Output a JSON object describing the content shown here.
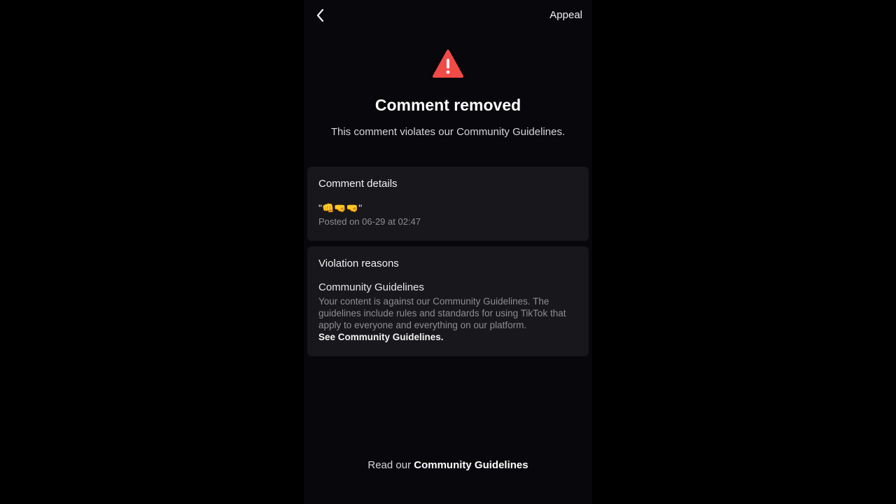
{
  "header": {
    "back_icon": "chevron-left-icon",
    "appeal_label": "Appeal"
  },
  "status": {
    "icon": "warning-triangle-icon",
    "icon_color": "#f04b46",
    "title": "Comment removed",
    "subtitle": "This comment violates our Community Guidelines."
  },
  "comment_details": {
    "heading": "Comment details",
    "comment": "\"👊🤜🤜\"",
    "posted": "Posted on 06-29 at 02:47"
  },
  "violation": {
    "heading": "Violation reasons",
    "reason_title": "Community Guidelines",
    "reason_body": "Your content is against our Community Guidelines. The guidelines include rules and standards for using TikTok that apply to everyone and everything on our platform.",
    "link_label": "See Community Guidelines."
  },
  "footer": {
    "prefix": "Read our",
    "link_label": "Community Guidelines"
  }
}
